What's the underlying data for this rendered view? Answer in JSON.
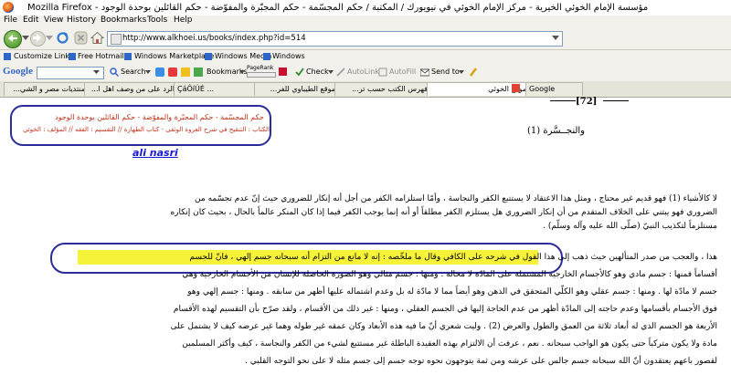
{
  "window": {
    "title": "مؤسسة الإمام الخوئي الخيرية - مركز الإمام الخوئي في نيويورك / المكتبة / حكم المجسّمة - حكم المجبّرة والمفوّضة - حكم القائلين بوحدة الوجود - Mozilla Firefox"
  },
  "menu": [
    "File",
    "Edit",
    "View",
    "History",
    "Bookmarks",
    "Tools",
    "Help"
  ],
  "nav": {
    "url": "http://www.alkhoei.us/books/index.php?id=514"
  },
  "bookmarks_bar": [
    "Customize Links",
    "Free Hotmail",
    "Windows Marketplace",
    "Windows Media",
    "Windows"
  ],
  "google_bar": {
    "logo": "Google",
    "search_label": "Search",
    "bookmarks_label": "Bookmarks",
    "pagerank_label": "PageRank",
    "check_label": "Check",
    "autolink_label": "AutoLink",
    "autofill_label": "AutoFill",
    "sendto_label": "Send to"
  },
  "tabs": [
    "منتديات مصر و الشي...",
    "الرد على من وصف اهل ا...",
    "ÇáÔíÚÉ ...",
    "موقع الطيباوي للفر...",
    "فهرس الكتب حسب تر...",
    "موقع الخوئي",
    "Google"
  ],
  "page": {
    "page_number": "[72]",
    "heading": "والنجــسَّرة (1)",
    "toc_line1": "حكم المجسّمة - حكم المجبّرة والمفوّضة - حكم القائلين بوحدة الوجود",
    "toc_line2": "الكتاب : التنقيح في شرح العروة الوثقى - كتاب الطهارة // التقسيم : الفقه // المؤلف : الخوئي",
    "signature": "ali nasri",
    "paragraph1": [
      "لا كالأشياء (1) فهو قديم غير محتاج ، ومثل هذا الاعتقاد لا يستتبع الكفر والنجاسة ، وأمّا استلزامه الكفر من أجل أنه إنكار للضروري حيث إنّ عدم تجسّمه من",
      "الضروري فهو يبتني على الخلاف المتقدم من أن إنكار الضروري هل يستلزم الكفر مطلقاً أو أنه إنما يوجب الكفر فيما إذا كان المنكر عالماً بالحال ، بحيث كان إنكاره",
      "مستلزماً لتكذيب النبيّ (صلّى الله عليه وآله وسلّم) ."
    ],
    "paragraph2": [
      "هذا ، والعجب من صدر المتألهين حيث ذهب إلى هذا القول في شرحه على الكافي وقال ما ملخّصه : إنه لا مانع من التزام أنه سبحانه جسم إلهي ، فانّ للجسم",
      "أقساماً فمنها : جسم مادي وهو كالأجسام الخارجية المشتملة على المادّة لا محالة . ومنها : جسم مثالي وهو الصورة الحاصلة للإنسان من الأجسام الخارجية وهي",
      "جسم لا مادّة لها . ومنها : جسم عقلي وهو الكلّي المتحقق في الذهن وهو أيضاً مما لا مادّة له بل وعدم اشتماله عليها أظهر من سابقه . ومنها : جسم إلهي وهو",
      "فوق الأجسام بأقسامها وعدم حاجته إلى المادّة أظهر من عدم الحاجة إليها في الجسم العقلي ، ومنها : غير ذلك من الأقسام ، ولقد صرّح بأن التقسيم لهذه الأقسام",
      "الأربعة هو الجسم الذي له أبعاد ثلاثة من العمق والطول والعرض (2) . وليت شعري أنّ ما فيه هذه الأبعاد وكان عمقه غير طوله وهما غير عرضه كيف لا يشتمل على",
      "مادة ولا يكون متركباً حتى يكون هو الواجب سبحانه . نعم ، عرفت أن الالتزام بهذه العقيدة الباطلة غير مستتبع لشيء من الكفر والنجاسة ، كيف وأكثر المسلمين",
      "لقصور باعهم يعتقدون أنّ الله سبحانه جسم جالس على عرشه ومن ثمة يتوجهون نحوه توجه جسم إلى جسم مثله لا على نحو التوجه القلبي ."
    ]
  }
}
